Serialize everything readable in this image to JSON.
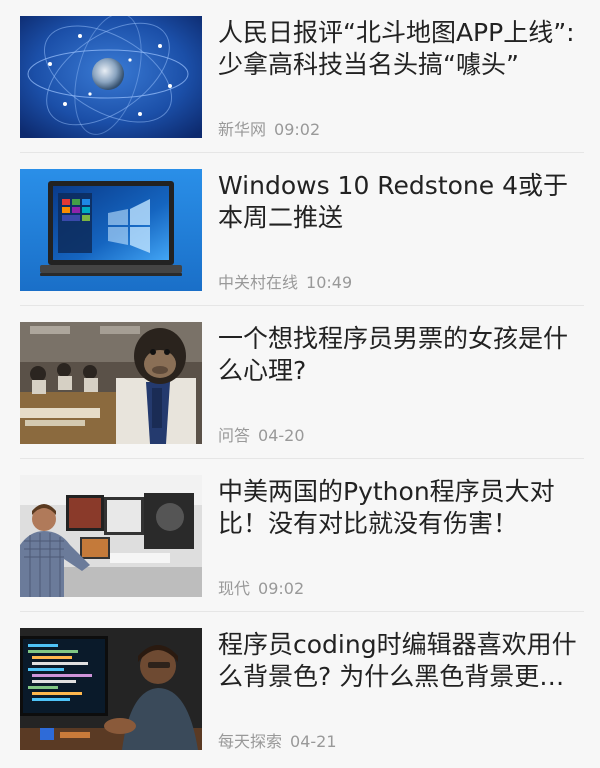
{
  "articles": [
    {
      "title": "人民日报评“北斗地图APP上线”:少拿高科技当名头搞“噱头”",
      "source": "新华网",
      "time": "09:02",
      "thumbnail_icon": "globe-satellite-image"
    },
    {
      "title": "Windows 10 Redstone 4或于本周二推送",
      "source": "中关村在线",
      "time": "10:49",
      "thumbnail_icon": "laptop-image"
    },
    {
      "title": "一个想找程序员男票的女孩是什么心理?",
      "source": "问答",
      "time": "04-20",
      "thumbnail_icon": "chimpanzee-office-image"
    },
    {
      "title": "中美两国的Python程序员大对比！没有对比就没有伤害！",
      "source": "现代",
      "time": "09:02",
      "thumbnail_icon": "programmer-desk-image"
    },
    {
      "title": "程序员coding时编辑器喜欢用什么背景色? 为什么黑色背景更受欢迎",
      "source": "每天探索",
      "time": "04-21",
      "thumbnail_icon": "coder-dark-screen-image"
    }
  ]
}
